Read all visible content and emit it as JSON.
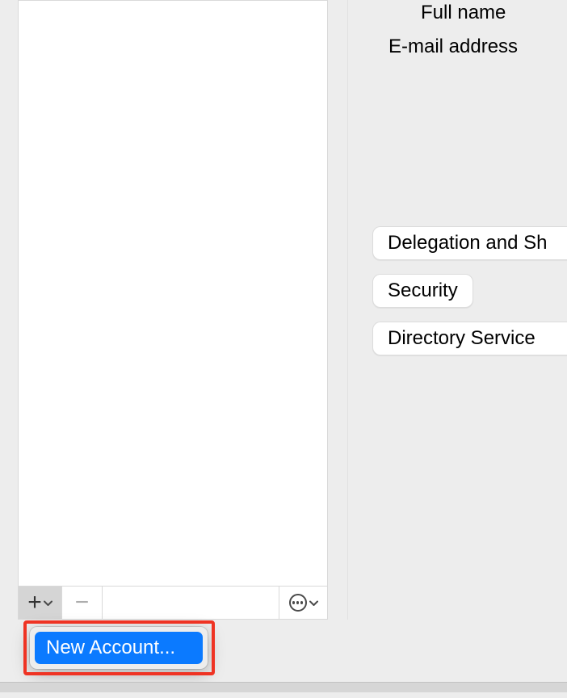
{
  "form": {
    "full_name_label": "Full name",
    "email_label": "E-mail address"
  },
  "buttons": {
    "delegation": "Delegation and Sh",
    "security": "Security",
    "directory": "Directory Service"
  },
  "footer": {
    "add_button": "+",
    "remove_button": "−"
  },
  "menu": {
    "new_account": "New Account..."
  }
}
